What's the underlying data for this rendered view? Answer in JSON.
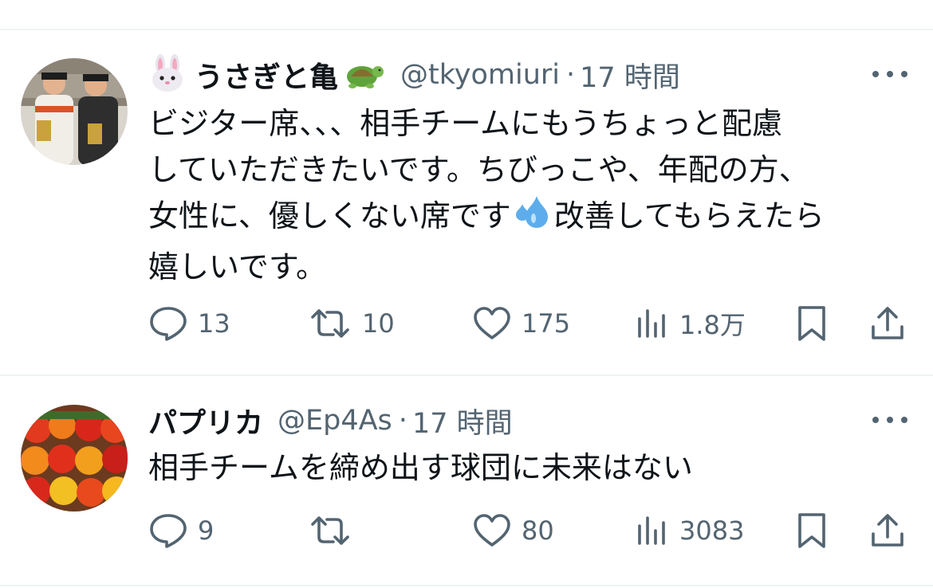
{
  "tweets": [
    {
      "display_name_prefix_emoji": "rabbit-face",
      "display_name": "うさぎと亀",
      "display_name_suffix_emoji": "turtle",
      "handle": "@tkyomiuri",
      "separator": "·",
      "time": "17 時間",
      "text": "ビジター席、、、相手チームにもうちょっと配慮\nしていただきたいです。ちびっこや、年配の方、\n女性に、優しくない席です",
      "text_emoji": "sweat-droplets",
      "text_tail": "改善してもらえたら\n嬉しいです。",
      "stats": {
        "replies": "13",
        "retweets": "10",
        "likes": "175",
        "views": "1.8万"
      }
    },
    {
      "display_name": "パプリカ",
      "handle": "@Ep4As",
      "separator": "·",
      "time": "17 時間",
      "text": "相手チームを締め出す球団に未来はない",
      "stats": {
        "replies": "9",
        "retweets": "",
        "likes": "80",
        "views": "3083"
      }
    }
  ],
  "icons": [
    "reply-icon",
    "retweet-icon",
    "like-icon",
    "views-icon",
    "bookmark-icon",
    "share-icon",
    "more-icon"
  ],
  "colors": {
    "text": "#0f1419",
    "secondary": "#536471",
    "divider": "#eff3f4",
    "background": "#ffffff"
  }
}
